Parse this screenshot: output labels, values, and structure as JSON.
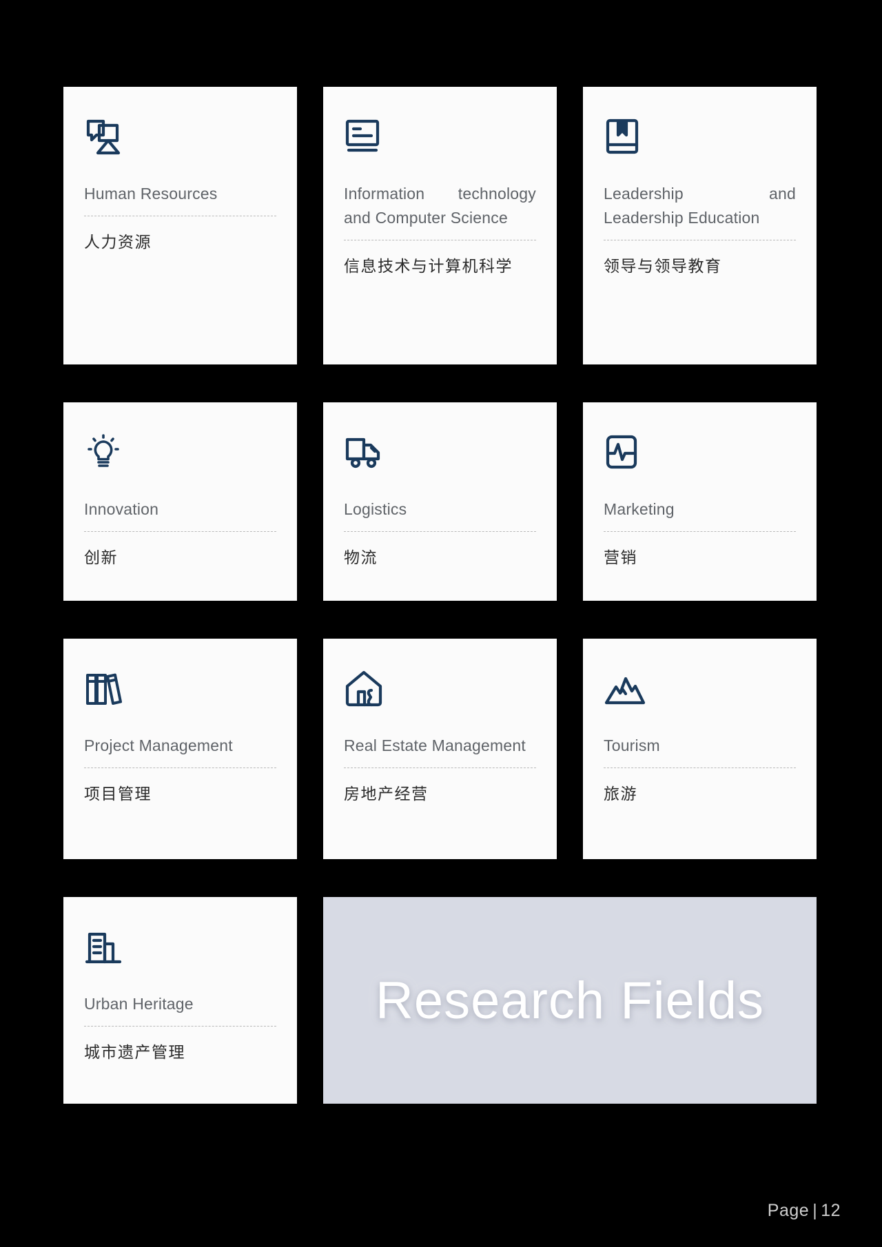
{
  "page": {
    "background_color": "#000000",
    "card_background": "#fbfbfb",
    "icon_color": "#1a3a5c",
    "divider_color": "#b9b9b9",
    "english_text_color": "#5f6368",
    "chinese_text_color": "#2b2b2b"
  },
  "cards": [
    {
      "icon": "two-users-icon",
      "title_en": "Human Resources",
      "title_zh": "人力资源"
    },
    {
      "icon": "id-card-icon",
      "title_en": "Information technology and Computer Science",
      "title_zh": "信息技术与计算机科学"
    },
    {
      "icon": "bookmark-book-icon",
      "title_en": "Leadership and Leadership Education",
      "title_zh": "领导与领导教育"
    },
    {
      "icon": "lightbulb-icon",
      "title_en": "Innovation",
      "title_zh": "创新"
    },
    {
      "icon": "delivery-truck-icon",
      "title_en": "Logistics",
      "title_zh": "物流"
    },
    {
      "icon": "pulse-chart-icon",
      "title_en": "Marketing",
      "title_zh": "营销"
    },
    {
      "icon": "books-icon",
      "title_en": "Project Management",
      "title_zh": "项目管理"
    },
    {
      "icon": "house-person-icon",
      "title_en": "Real Estate Management",
      "title_zh": "房地产经营"
    },
    {
      "icon": "mountains-icon",
      "title_en": "Tourism",
      "title_zh": "旅游"
    },
    {
      "icon": "office-buildings-icon",
      "title_en": "Urban Heritage",
      "title_zh": "城市遗产管理"
    }
  ],
  "panel": {
    "title": "Research Fields",
    "background_color": "#d7dae4",
    "text_color": "#ffffff"
  },
  "footer": {
    "label": "Page",
    "separator": "|",
    "number": "12"
  }
}
